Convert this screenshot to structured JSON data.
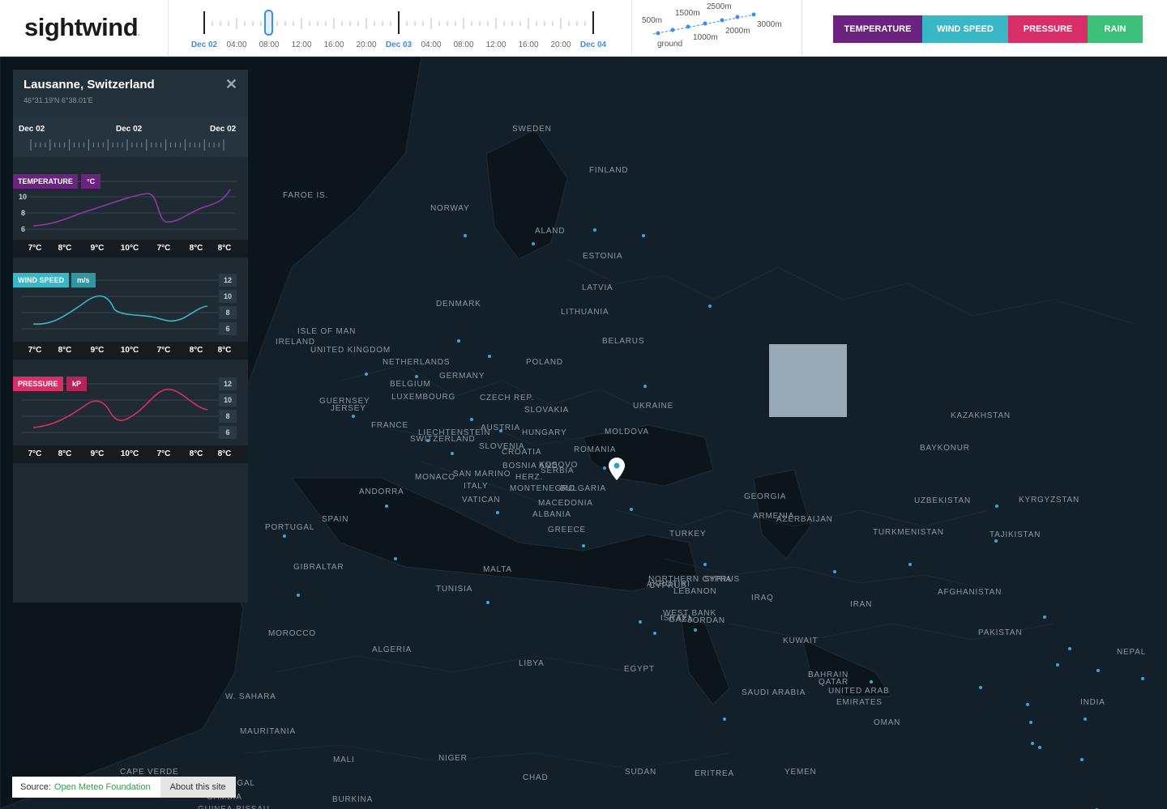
{
  "app": {
    "logo": "sightwind",
    "logo_mark": "."
  },
  "timeline": {
    "labels": [
      "Dec 02",
      "04:00",
      "08:00",
      "12:00",
      "16:00",
      "20:00",
      "Dec 03",
      "04:00",
      "08:00",
      "12:00",
      "16:00",
      "20:00",
      "Dec 04"
    ]
  },
  "altitude": {
    "levels": [
      "ground",
      "500m",
      "1000m",
      "1500m",
      "2000m",
      "2500m",
      "3000m"
    ]
  },
  "layers": {
    "temperature": "TEMPERATURE",
    "wind_speed": "WIND SPEED",
    "pressure": "PRESSURE",
    "rain": "RAIN"
  },
  "panel": {
    "city": "Lausanne, Switzerland",
    "coords": "46°31.19'N 6°38.01'E",
    "close": "✕",
    "mini_timeline": [
      "Dec 02",
      "Dec 02",
      "Dec 02"
    ],
    "temperature": {
      "label": "TEMPERATURE",
      "unit": "°C",
      "y_ticks": [
        "10",
        "8",
        "6"
      ],
      "values": [
        "7°C",
        "8°C",
        "9°C",
        "10°C",
        "7°C",
        "8°C",
        "8°C"
      ]
    },
    "wind": {
      "label": "WIND SPEED",
      "unit": "m/s",
      "y_ticks": [
        "12",
        "10",
        "8",
        "6"
      ],
      "values": [
        "7°C",
        "8°C",
        "9°C",
        "10°C",
        "7°C",
        "8°C",
        "8°C"
      ]
    },
    "pressure": {
      "label": "PRESSURE",
      "unit": "kP",
      "y_ticks": [
        "12",
        "10",
        "8",
        "6"
      ],
      "values": [
        "7°C",
        "8°C",
        "9°C",
        "10°C",
        "7°C",
        "8°C",
        "8°C"
      ]
    }
  },
  "map_labels": [
    "SWEDEN",
    "FINLAND",
    "FAROE IS.",
    "NORWAY",
    "ALAND",
    "ESTONIA",
    "LATVIA",
    "DENMARK",
    "LITHUANIA",
    "ISLE OF MAN",
    "IRELAND",
    "UNITED KINGDOM",
    "NETHERLANDS",
    "BELARUS",
    "POLAND",
    "BELGIUM",
    "GERMANY",
    "LUXEMBOURG",
    "CZECH REP.",
    "GUERNSEY",
    "JERSEY",
    "SLOVAKIA",
    "UKRAINE",
    "FRANCE",
    "LIECHTENSTEIN",
    "AUSTRIA",
    "SWITZERLAND",
    "HUNGARY",
    "MOLDOVA",
    "KAZAKHSTAN",
    "SLOVENIA",
    "CROATIA",
    "ROMANIA",
    "BAYKONUR",
    "BOSNIA AND",
    "HERZ.",
    "SERBIA",
    "KOSOVO",
    "MONACO",
    "SAN MARINO",
    "ANDORRA",
    "ITALY",
    "MONTENEGRO",
    "BULGARIA",
    "GEORGIA",
    "UZBEKISTAN",
    "KYRGYZSTAN",
    "VATICAN",
    "MACEDONIA",
    "ARMENIA",
    "AZERBAIJAN",
    "SPAIN",
    "ALBANIA",
    "PORTUGAL",
    "GREECE",
    "TURKEY",
    "TURKMENISTAN",
    "TAJIKISTAN",
    "GIBRALTAR",
    "MALTA",
    "NORTHERN CYPRUS",
    "CYPRUS",
    "SYRIA",
    "AKROTIRI",
    "TUNISIA",
    "LEBANON",
    "IRAQ",
    "AFGHANISTAN",
    "IRAN",
    "WEST BANK",
    "GAZA",
    "JORDAN",
    "MOROCCO",
    "ISRAEL",
    "PAKISTAN",
    "KUWAIT",
    "ALGERIA",
    "NEPAL",
    "LIBYA",
    "EGYPT",
    "BAHRAIN",
    "QATAR",
    "SAUDI ARABIA",
    "UNITED ARAB",
    "EMIRATES",
    "W. SAHARA",
    "INDIA",
    "OMAN",
    "MAURITANIA",
    "MALI",
    "NIGER",
    "CAPE VERDE",
    "SENEGAL",
    "CHAD",
    "SUDAN",
    "ERITREA",
    "YEMEN",
    "GAMBIA",
    "GUINEA-BISSAU",
    "BURKINA"
  ],
  "footer": {
    "source_label": "Source:",
    "source_link": "Open Meteo Foundation",
    "about": "About this site"
  }
}
